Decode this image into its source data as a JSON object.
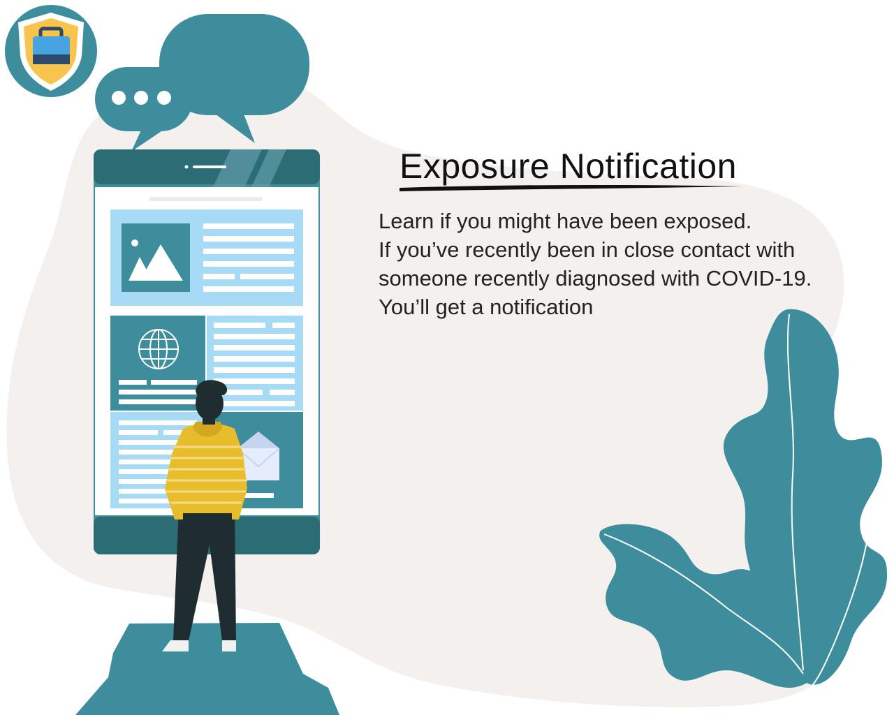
{
  "headline": "Exposure Notification",
  "body_lines": [
    "Learn if you might have been exposed.",
    "If you’ve recently been in close contact with",
    "someone recently diagnosed with COVID-19.",
    "You’ll get a notification"
  ],
  "colors": {
    "teal": "#3d8d9c",
    "teal_dark": "#2c6c75",
    "teal_light": "#5f9ea8",
    "blob": "#f4f0ee",
    "card_blue": "#a6daf5",
    "shirt_yellow": "#e8bd2b",
    "pants_dark": "#1f2d30",
    "shield_yellow": "#f9c44b",
    "shield_blue": "#47a4e0"
  },
  "icons": [
    "shield-lock-icon",
    "chat-bubble-icon",
    "speech-bubble-icon",
    "image-icon",
    "globe-icon",
    "envelope-icon",
    "leaf-decoration"
  ]
}
